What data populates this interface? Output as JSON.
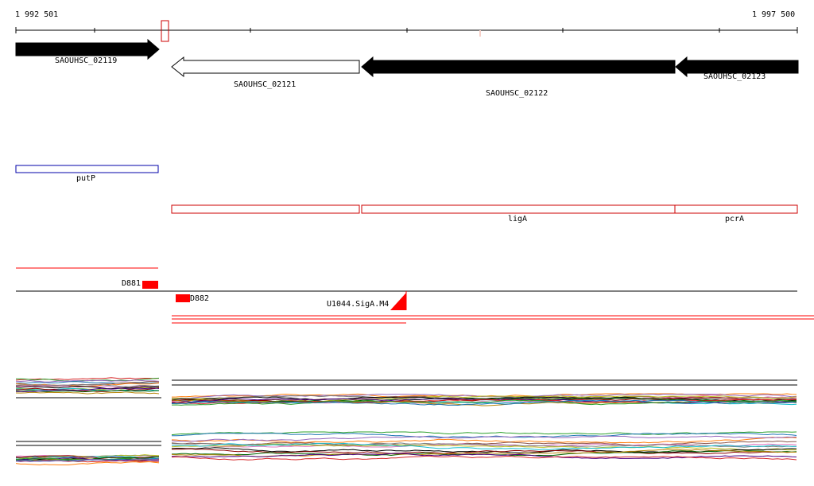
{
  "ruler": {
    "start_label": "1 992 501",
    "end_label": "1 997 500"
  },
  "genes": [
    {
      "name": "SAOUHSC_02119",
      "strand": "+",
      "fill": "#000000"
    },
    {
      "name": "SAOUHSC_02121",
      "strand": "-",
      "fill": "#ffffff"
    },
    {
      "name": "SAOUHSC_02122",
      "strand": "-",
      "fill": "#000000"
    },
    {
      "name": "SAOUHSC_02123",
      "strand": "-",
      "fill": "#000000"
    }
  ],
  "annotations": {
    "putP": "putP",
    "ligA": "ligA",
    "pcrA": "pcrA",
    "putP_color": "#0000aa",
    "ligA_color": "#cc0000"
  },
  "features": {
    "d881": "D881",
    "d882": "D882",
    "promoter": "U1044.SigA.M4",
    "feature_color": "#ff0000"
  },
  "expression": {
    "series_colors": [
      "#d62728",
      "#2ca02c",
      "#1f77b4",
      "#ff7f0e",
      "#9467bd",
      "#8c564b",
      "#e377c2",
      "#7f7f7f",
      "#bcbd22",
      "#17becf",
      "#000000",
      "#8b0000",
      "#006400",
      "#b8860b",
      "#4b0082"
    ]
  }
}
